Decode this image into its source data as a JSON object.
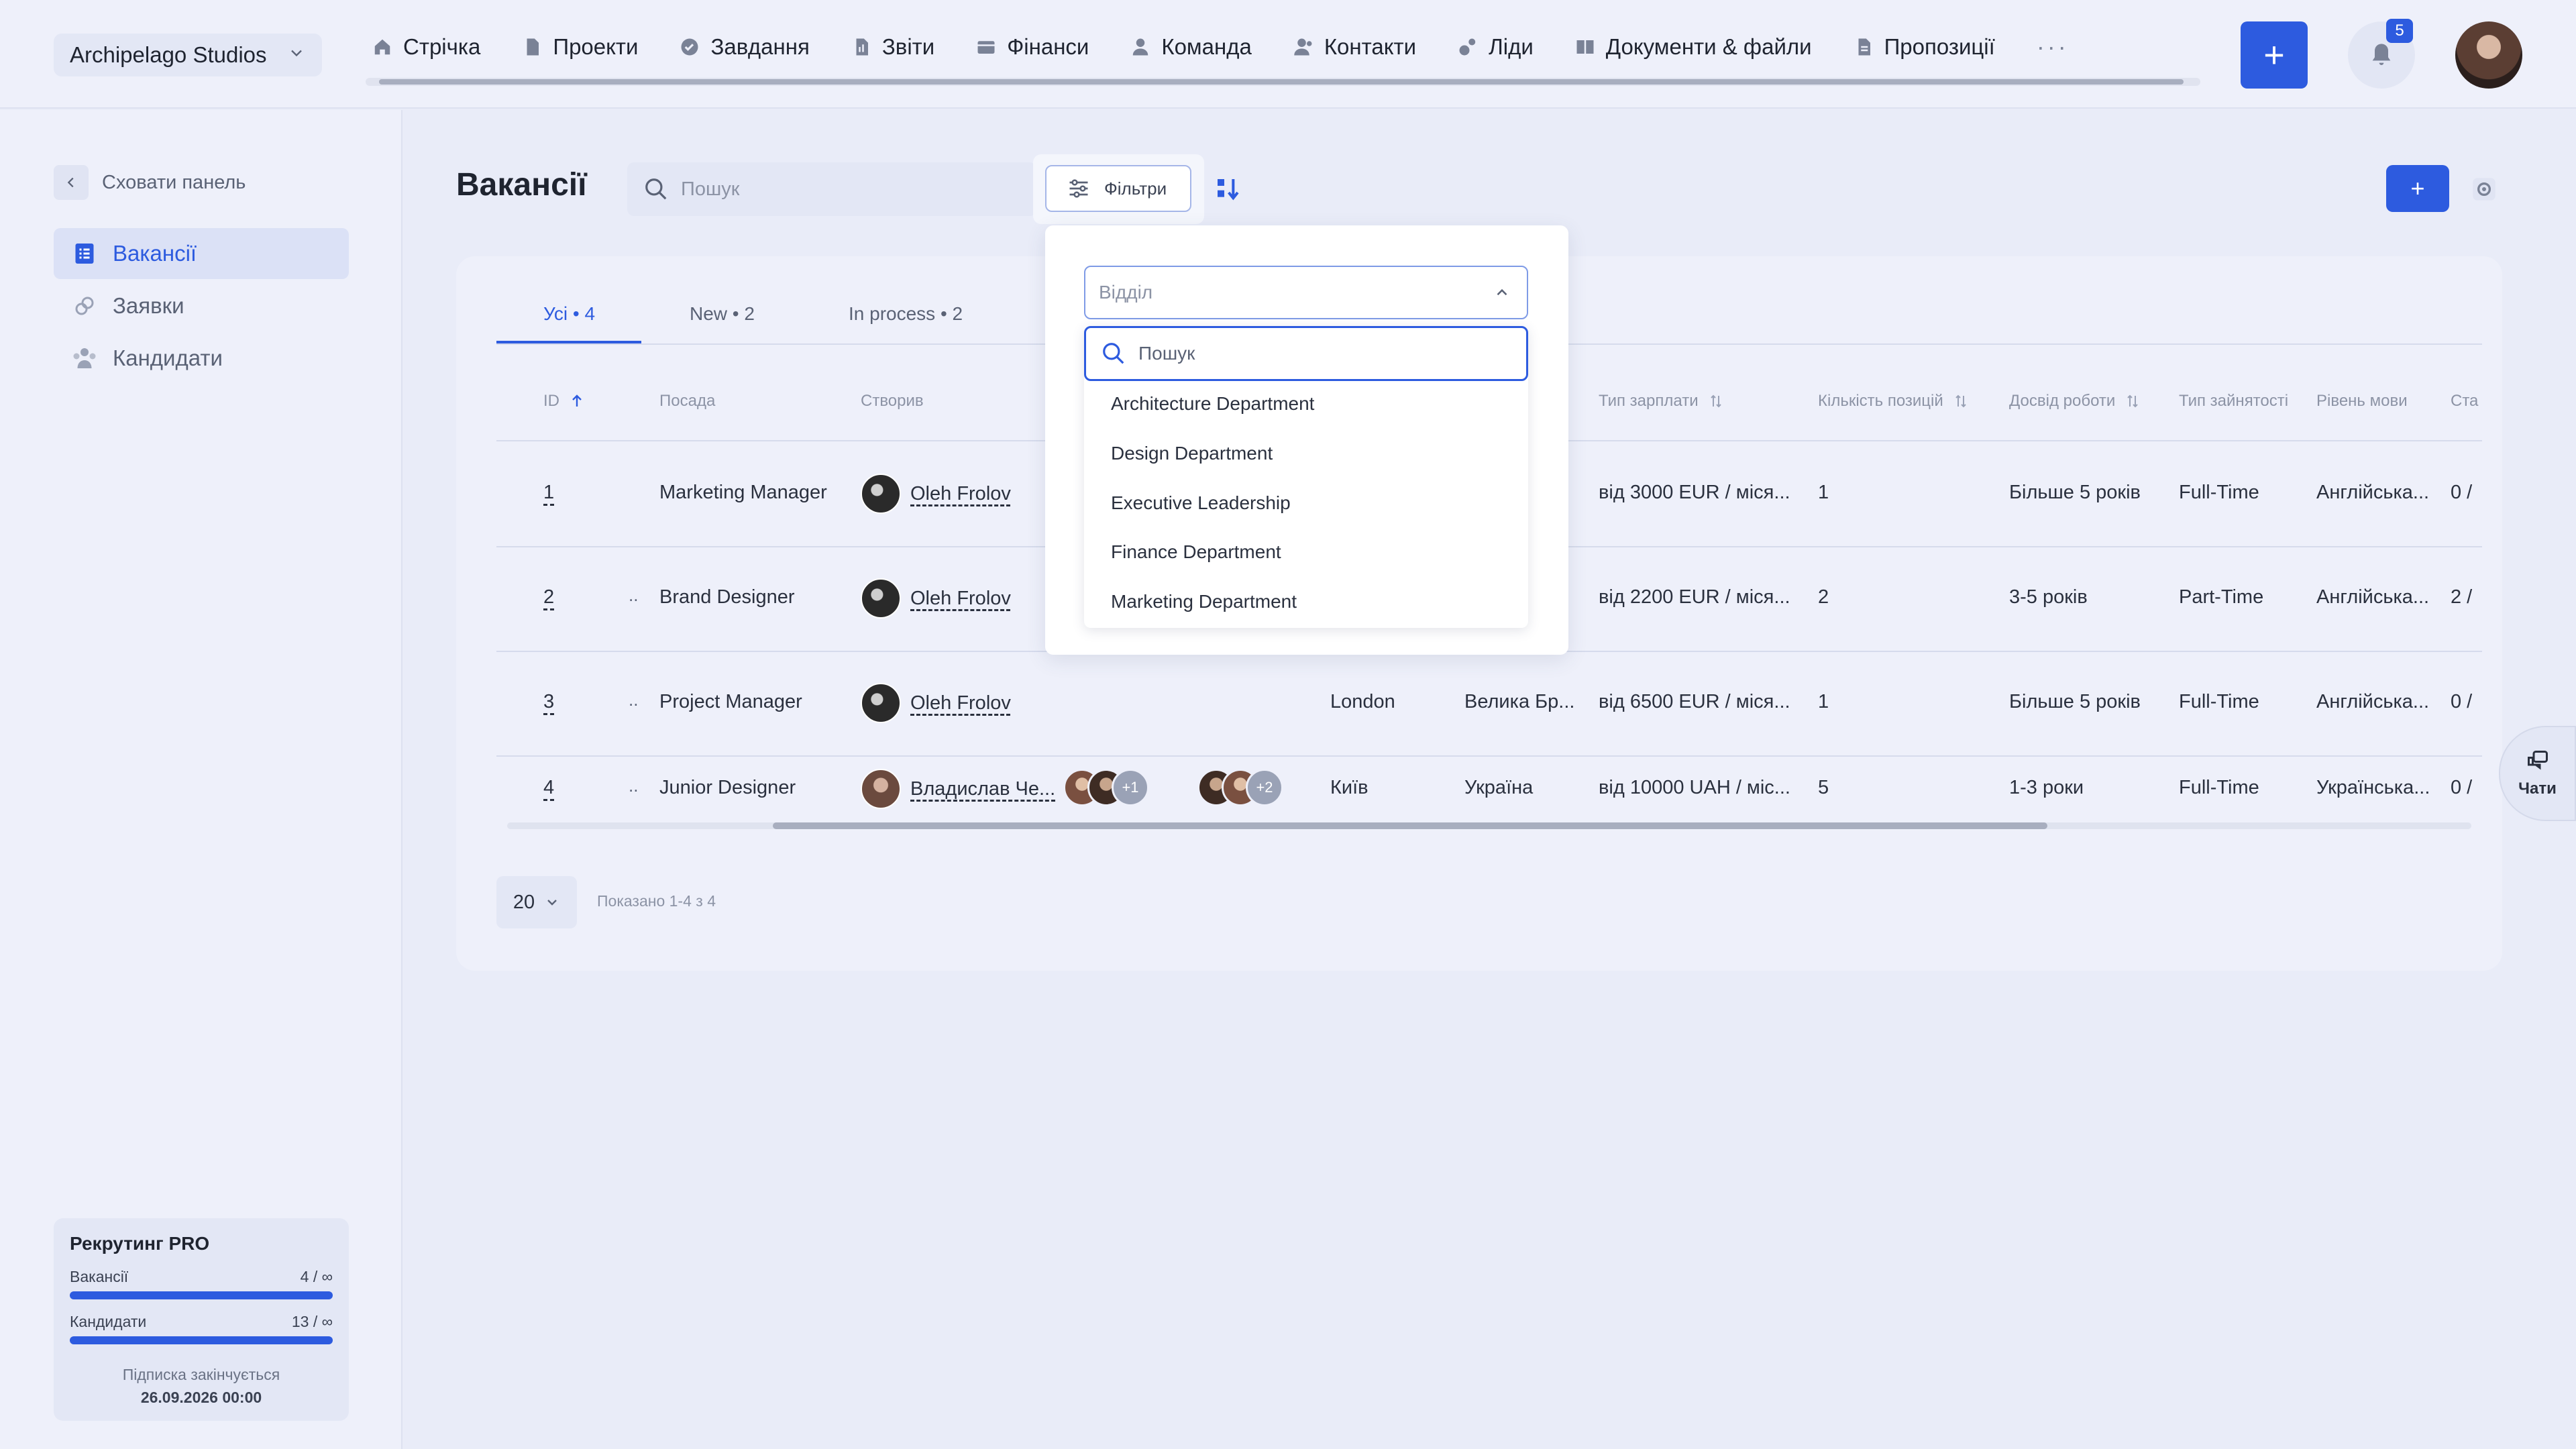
{
  "company": "Archipelago Studios",
  "nav": [
    "Стрічка",
    "Проекти",
    "Завдання",
    "Звіти",
    "Фінанси",
    "Команда",
    "Контакти",
    "Ліди",
    "Документи & файли",
    "Пропозиції"
  ],
  "nav_more": "···",
  "add_label": "+",
  "notifications_count": "5",
  "sidebar": {
    "hide_panel": "Сховати панель",
    "items": [
      "Вакансії",
      "Заявки",
      "Кандидати"
    ]
  },
  "plan": {
    "title": "Рекрутинг PRO",
    "vacancies_label": "Вакансії",
    "vacancies_value": "4 / ∞",
    "candidates_label": "Кандидати",
    "candidates_value": "13 / ∞",
    "note": "Підписка закінчується",
    "date": "26.09.2026 00:00"
  },
  "page_title": "Вакансії",
  "search_placeholder": "Пошук",
  "filters_label": "Фільтри",
  "tabs": [
    "Усі • 4",
    "New • 2",
    "In process • 2"
  ],
  "columns": {
    "id": "ID",
    "position": "Посада",
    "created": "Створив",
    "salary_type": "Тип зарплати",
    "positions_count": "Кількість позицій",
    "experience": "Досвід роботи",
    "employment": "Тип зайнятості",
    "language": "Рівень мови",
    "status": "Ста"
  },
  "rows": [
    {
      "id": "1",
      "position": "Marketing Manager",
      "creator": "Oleh Frolov",
      "city": "",
      "country": "",
      "salary": "від 3000 EUR / міся...",
      "count": "1",
      "experience": "Більше 5 років",
      "employment": "Full-Time",
      "language": "Англійська...",
      "status": "0 /"
    },
    {
      "id": "2",
      "position": "Brand Designer",
      "creator": "Oleh Frolov",
      "city": "",
      "country": "",
      "salary": "від 2200 EUR / міся...",
      "count": "2",
      "experience": "3-5 років",
      "employment": "Part-Time",
      "language": "Англійська...",
      "status": "2 /"
    },
    {
      "id": "3",
      "position": "Project Manager",
      "creator": "Oleh Frolov",
      "city": "London",
      "country": "Велика Бр...",
      "salary": "від 6500 EUR / міся...",
      "count": "1",
      "experience": "Більше 5 років",
      "employment": "Full-Time",
      "language": "Англійська...",
      "status": "0 /"
    },
    {
      "id": "4",
      "position": "Junior Designer",
      "creator": "Владислав Че...",
      "city": "Київ",
      "country": "Україна",
      "salary": "від 10000 UAH / міс...",
      "count": "5",
      "experience": "1-3 роки",
      "employment": "Full-Time",
      "language": "Українська...",
      "status": "0 /"
    }
  ],
  "row_dots": "..",
  "row4_groups": [
    "+1",
    "+2"
  ],
  "pager_size": "20",
  "shown_text": "Показано 1-4 з 4",
  "dropdown": {
    "placeholder": "Відділ",
    "search_placeholder": "Пошук",
    "options": [
      "Architecture Department",
      "Design Department",
      "Executive Leadership",
      "Finance Department",
      "Marketing Department"
    ]
  },
  "chat_label": "Чати",
  "colors": {
    "accent": "#2d5bdf",
    "background": "#e9ecf8"
  }
}
